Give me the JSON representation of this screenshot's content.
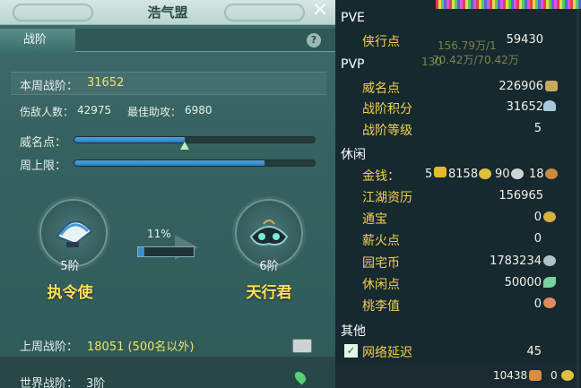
{
  "window": {
    "title": "浩气盟"
  },
  "tabs": [
    {
      "label": "战阶"
    }
  ],
  "help_icon": "?",
  "stats": {
    "week_rank_label": "本周战阶：",
    "week_rank_value": "31652",
    "kills_label": "伤敌人数：",
    "kills_value": "42975",
    "assist_label": "最佳助攻：",
    "assist_value": "6980",
    "prestige_label": "威名点：",
    "week_cap_label": "周上限："
  },
  "progress": {
    "prestige_fraction": 0.46,
    "cap_fraction": 0.79,
    "next_rank_percent": "11%",
    "next_rank_fraction": 0.11
  },
  "rank_current": {
    "tier": "5阶",
    "name": "执令使"
  },
  "rank_next": {
    "tier": "6阶",
    "name": "天行君"
  },
  "last_week": {
    "label": "上周战阶：",
    "value": "18051 (500名以外)"
  },
  "world_rank": {
    "label": "世界战阶：",
    "value": "3阶"
  },
  "overlay": {
    "bg_values_1": "156.79万/1",
    "bg_values_2": "70.42万/70.42万",
    "bg_level": "130"
  },
  "sidebar": {
    "pve": {
      "title": "PVE",
      "items": [
        {
          "label": "侠行点",
          "value": "59430"
        }
      ]
    },
    "pvp": {
      "title": "PVP",
      "items": [
        {
          "label": "威名点",
          "value": "226906"
        },
        {
          "label": "战阶积分",
          "value": "31652"
        },
        {
          "label": "战阶等级",
          "value": "5"
        }
      ]
    },
    "leisure": {
      "title": "休闲",
      "money_label": "金钱：",
      "money_gold_bricks": "5",
      "money_gold": "8158",
      "money_silver": "90",
      "money_copper": "18",
      "items": [
        {
          "label": "江湖资历",
          "value": "156965"
        },
        {
          "label": "通宝",
          "value": "0"
        },
        {
          "label": "薪火点",
          "value": "0"
        },
        {
          "label": "园宅币",
          "value": "1783234"
        },
        {
          "label": "休闲点",
          "value": "50000"
        },
        {
          "label": "桃李值",
          "value": "0"
        }
      ]
    },
    "other": {
      "title": "其他",
      "items": [
        {
          "label": "网络延迟",
          "value": "45"
        }
      ]
    },
    "footer": {
      "value_1": "10438",
      "value_2": "0"
    }
  },
  "colors": {
    "accent_yellow": "#f2d14e",
    "bar_blue": "#2b7ec4"
  }
}
